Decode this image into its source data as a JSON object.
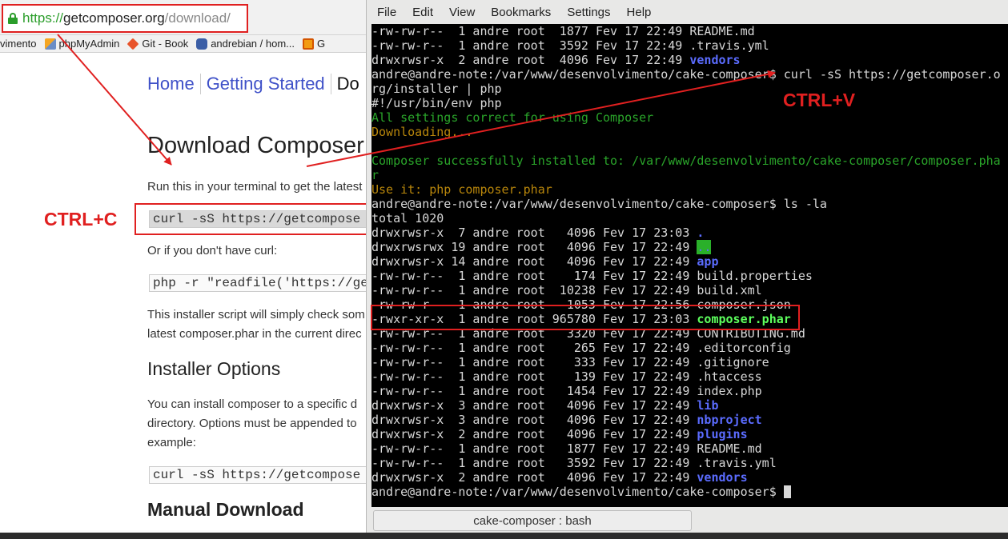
{
  "browser": {
    "url": {
      "scheme": "https://",
      "host": "getcomposer.org",
      "path": "/download/"
    },
    "bookmarks": [
      "vimento",
      "phpMyAdmin",
      "Git - Book",
      "andrebian / hom...",
      "G"
    ],
    "nav": [
      "Home",
      "Getting Started",
      "Do"
    ],
    "page_title": "Download Composer",
    "intro": "Run this in your terminal to get the latest",
    "code_curl": "curl -sS https://getcompose",
    "no_curl": "Or if you don't have curl:",
    "code_php": "php -r \"readfile('https://ge",
    "installer_text_1": "This installer script will simply check som",
    "installer_text_2": "latest composer.phar in the current direc",
    "installer_options": "Installer Options",
    "options_text_1": "You can install composer to a specific d",
    "options_text_2": "directory. Options must be appended to",
    "options_text_3": "example:",
    "code_curl_2": "curl -sS https://getcompose",
    "manual_download": "Manual Download"
  },
  "annotations": {
    "copy": "CTRL+C",
    "paste": "CTRL+V"
  },
  "terminal": {
    "menu": [
      "File",
      "Edit",
      "View",
      "Bookmarks",
      "Settings",
      "Help"
    ],
    "lines": [
      [
        {
          "t": "-rw-rw-r--  1 andre root  1877 Fev 17 22:49 README.md",
          "c": "c-default"
        }
      ],
      [
        {
          "t": "-rw-rw-r--  1 andre root  3592 Fev 17 22:49 .travis.yml",
          "c": "c-default"
        }
      ],
      [
        {
          "t": "drwxrwsr-x  2 andre root  4096 Fev 17 22:49 ",
          "c": "c-default"
        },
        {
          "t": "vendors",
          "c": "dir"
        }
      ],
      [
        {
          "t": "andre@andre-note:/var/www/desenvolvimento/cake-composer$ curl -sS https://getcomposer.o",
          "c": "c-default"
        }
      ],
      [
        {
          "t": "rg/installer | php",
          "c": "c-default"
        }
      ],
      [
        {
          "t": "#!/usr/bin/env php",
          "c": "c-default"
        }
      ],
      [
        {
          "t": "All settings correct for using Composer",
          "c": "c-green"
        }
      ],
      [
        {
          "t": "Downloading...",
          "c": "c-orange"
        }
      ],
      [
        {
          "t": "",
          "c": "c-default"
        }
      ],
      [
        {
          "t": "Composer successfully installed to: /var/www/desenvolvimento/cake-composer/composer.pha",
          "c": "c-green"
        }
      ],
      [
        {
          "t": "r",
          "c": "c-green"
        }
      ],
      [
        {
          "t": "Use it: php composer.phar",
          "c": "c-orange"
        }
      ],
      [
        {
          "t": "andre@andre-note:/var/www/desenvolvimento/cake-composer$ ls -la",
          "c": "c-default"
        }
      ],
      [
        {
          "t": "total 1020",
          "c": "c-default"
        }
      ],
      [
        {
          "t": "drwxrwsr-x  7 andre root   4096 Fev 17 23:03 ",
          "c": "c-default"
        },
        {
          "t": ".",
          "c": "dir"
        }
      ],
      [
        {
          "t": "drwxrwsrwx 19 andre root   4096 Fev 17 22:49 ",
          "c": "c-default"
        },
        {
          "t": "..",
          "c": "dir-green-bg"
        }
      ],
      [
        {
          "t": "drwxrwsr-x 14 andre root   4096 Fev 17 22:49 ",
          "c": "c-default"
        },
        {
          "t": "app",
          "c": "dir"
        }
      ],
      [
        {
          "t": "-rw-rw-r--  1 andre root    174 Fev 17 22:49 build.properties",
          "c": "c-default"
        }
      ],
      [
        {
          "t": "-rw-rw-r--  1 andre root  10238 Fev 17 22:49 build.xml",
          "c": "c-default"
        }
      ],
      [
        {
          "t": "-rw-rw-r--  1 andre root   1053 Fev 17 22:56 composer.json",
          "c": "c-default"
        }
      ],
      [
        {
          "t": "-rwxr-xr-x  1 andre root 965780 Fev 17 23:03 ",
          "c": "c-default"
        },
        {
          "t": "composer.phar",
          "c": "exec"
        }
      ],
      [
        {
          "t": "-rw-rw-r--  1 andre root   3320 Fev 17 22:49 CONTRIBUTING.md",
          "c": "c-default"
        }
      ],
      [
        {
          "t": "-rw-rw-r--  1 andre root    265 Fev 17 22:49 .editorconfig",
          "c": "c-default"
        }
      ],
      [
        {
          "t": "-rw-rw-r--  1 andre root    333 Fev 17 22:49 .gitignore",
          "c": "c-default"
        }
      ],
      [
        {
          "t": "-rw-rw-r--  1 andre root    139 Fev 17 22:49 .htaccess",
          "c": "c-default"
        }
      ],
      [
        {
          "t": "-rw-rw-r--  1 andre root   1454 Fev 17 22:49 index.php",
          "c": "c-default"
        }
      ],
      [
        {
          "t": "drwxrwsr-x  3 andre root   4096 Fev 17 22:49 ",
          "c": "c-default"
        },
        {
          "t": "lib",
          "c": "dir"
        }
      ],
      [
        {
          "t": "drwxrwsr-x  3 andre root   4096 Fev 17 22:49 ",
          "c": "c-default"
        },
        {
          "t": "nbproject",
          "c": "dir"
        }
      ],
      [
        {
          "t": "drwxrwsr-x  2 andre root   4096 Fev 17 22:49 ",
          "c": "c-default"
        },
        {
          "t": "plugins",
          "c": "dir"
        }
      ],
      [
        {
          "t": "-rw-rw-r--  1 andre root   1877 Fev 17 22:49 README.md",
          "c": "c-default"
        }
      ],
      [
        {
          "t": "-rw-rw-r--  1 andre root   3592 Fev 17 22:49 .travis.yml",
          "c": "c-default"
        }
      ],
      [
        {
          "t": "drwxrwsr-x  2 andre root   4096 Fev 17 22:49 ",
          "c": "c-default"
        },
        {
          "t": "vendors",
          "c": "dir"
        }
      ],
      [
        {
          "t": "andre@andre-note:/var/www/desenvolvimento/cake-composer$ ",
          "c": "c-default"
        }
      ]
    ],
    "status_title": "cake-composer : bash"
  },
  "colors": {
    "annotation": "#e02020",
    "terminal_bg": "#000000",
    "link": "#3f51c8",
    "secure": "#2a9d2a"
  }
}
